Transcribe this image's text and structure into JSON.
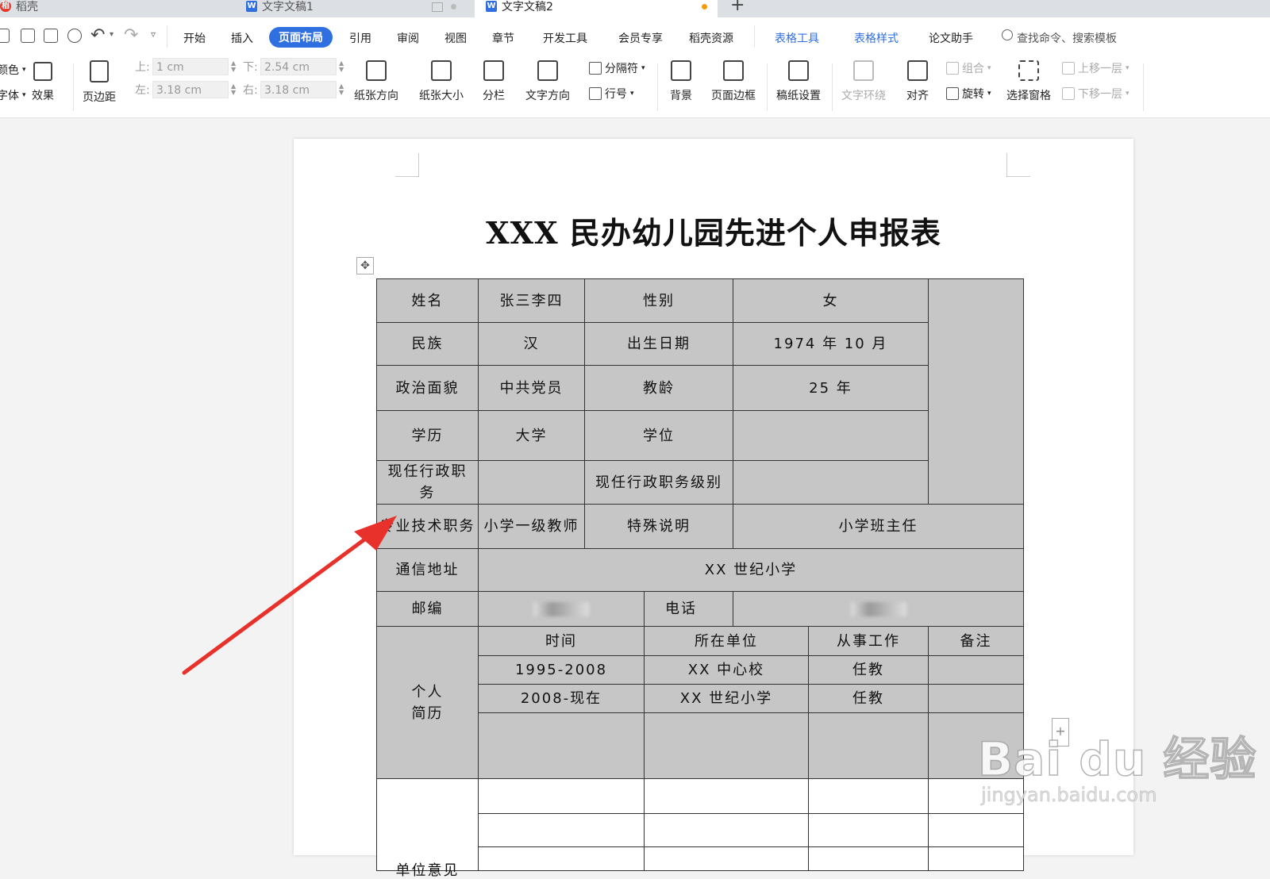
{
  "tabs": [
    {
      "label": "稻壳"
    },
    {
      "label": "文字文稿1"
    },
    {
      "label": "文字文稿2"
    }
  ],
  "new_tab": "+",
  "menu": [
    "开始",
    "插入",
    "页面布局",
    "引用",
    "审阅",
    "视图",
    "章节",
    "开发工具",
    "会员专享",
    "稻壳资源",
    "表格工具",
    "表格样式",
    "论文助手"
  ],
  "search_placeholder": "查找命令、搜索模板",
  "ribbon": {
    "color_label": "颜色",
    "font_label": "字体",
    "effect_label": "效果",
    "margin_label": "页边距",
    "top_label": "上:",
    "top_value": "1 cm",
    "bottom_label": "下:",
    "bottom_value": "2.54 cm",
    "left_label": "左:",
    "left_value": "3.18 cm",
    "right_label": "右:",
    "right_value": "3.18 cm",
    "orientation": "纸张方向",
    "size": "纸张大小",
    "columns": "分栏",
    "text_direction": "文字方向",
    "breaks": "分隔符",
    "line_numbers": "行号",
    "background": "背景",
    "page_border": "页面边框",
    "manuscript": "稿纸设置",
    "text_wrap": "文字环绕",
    "align": "对齐",
    "group": "组合",
    "rotate": "旋转",
    "selection_pane": "选择窗格",
    "bring_forward": "上移一层",
    "send_backward": "下移一层"
  },
  "document": {
    "title": "XXX 民办幼儿园先进个人申报表",
    "table": {
      "name_label": "姓名",
      "name_value": "张三李四",
      "gender_label": "性别",
      "gender_value": "女",
      "ethnicity_label": "民族",
      "ethnicity_value": "汉",
      "birth_label": "出生日期",
      "birth_value": "1974 年 10 月",
      "politics_label": "政治面貌",
      "politics_value": "中共党员",
      "teaching_years_label": "教龄",
      "teaching_years_value": "25 年",
      "education_label": "学历",
      "education_value": "大学",
      "degree_label": "学位",
      "degree_value": "",
      "admin_post_label": "现任行政职　务",
      "admin_post_value": "",
      "admin_level_label": "现任行政职务级别",
      "admin_level_value": "",
      "tech_post_label": "专业技术职务",
      "tech_post_value": "小学一级教师",
      "special_label": "特殊说明",
      "special_value": "小学班主任",
      "address_label": "通信地址",
      "address_value": "XX 世纪小学",
      "zip_label": "邮编",
      "phone_label": "电话",
      "resume_label": "个人简历",
      "resume_headers": [
        "时间",
        "所在单位",
        "从事工作",
        "备注"
      ],
      "resume_rows": [
        [
          "1995-2008",
          "XX 中心校",
          "任教",
          ""
        ],
        [
          "2008-现在",
          "XX 世纪小学",
          "任教",
          ""
        ]
      ],
      "next_section_label": "单位意见"
    }
  },
  "watermark": {
    "brand": "Bai du 经验",
    "site": "jingyan.baidu.com"
  },
  "colors": {
    "accent": "#2f6fe0",
    "arrow": "#e8312a",
    "table_fill": "#c6c6c6"
  }
}
